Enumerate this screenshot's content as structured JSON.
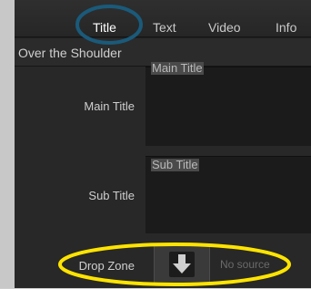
{
  "tabs": [
    {
      "label": "Title",
      "active": true
    },
    {
      "label": "Text",
      "active": false
    },
    {
      "label": "Video",
      "active": false
    },
    {
      "label": "Info",
      "active": false
    }
  ],
  "header": {
    "title": "Over the Shoulder"
  },
  "fields": {
    "main_title": {
      "label": "Main  Title",
      "value": "Main Title"
    },
    "sub_title": {
      "label": "Sub Title",
      "value": "Sub Title"
    },
    "drop_zone": {
      "label": "Drop Zone",
      "status": "No source",
      "icon": "download-arrow-icon"
    }
  },
  "highlights": {
    "title_tab_circle_color": "#1a5a7a",
    "drop_zone_circle_color": "#ffe400"
  }
}
